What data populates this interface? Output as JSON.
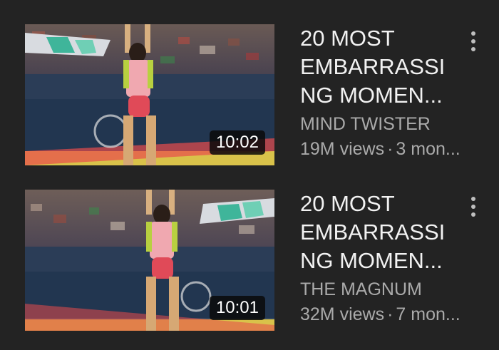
{
  "videos": [
    {
      "duration": "10:02",
      "title_lines": [
        "20 MOST",
        "EMBARRASSI",
        "NG MOMEN..."
      ],
      "channel": "MIND TWISTER",
      "views": "19M views",
      "age": "3 mon...",
      "menu_icon": "three-dot-vertical-icon"
    },
    {
      "duration": "10:01",
      "title_lines": [
        "20 MOST",
        "EMBARRASSI",
        "NG MOMEN..."
      ],
      "channel": "THE MAGNUM",
      "views": "32M views",
      "age": "7 mon...",
      "menu_icon": "three-dot-vertical-icon"
    }
  ],
  "separator": "·",
  "colors": {
    "background": "#232323",
    "title": "#f2f2f2",
    "secondary_text": "#aaaaaa",
    "duration_badge": "#0a0a0a"
  }
}
